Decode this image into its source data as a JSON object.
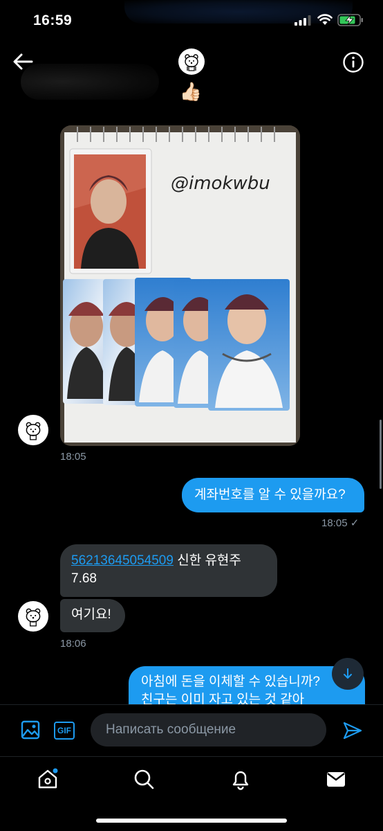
{
  "status": {
    "time": "16:59"
  },
  "header": {
    "reaction_emoji": "👍🏻"
  },
  "photo_message": {
    "image_handwriting": "@imokwbu",
    "time": "18:05"
  },
  "messages": {
    "out1": {
      "text": "계좌번호를 알 수 있을까요?",
      "time": "18:05",
      "status_icon": "✓"
    },
    "in1": {
      "account_number": "56213645054509",
      "rest": " 신한 유현주",
      "line2": "7.68"
    },
    "in2": {
      "text": "여기요!",
      "time": "18:06"
    },
    "out2": {
      "line1": "아침에 돈을 이체할 수 있습니까?",
      "line2": "친구는 이미 자고 있는 것 같아"
    }
  },
  "composer": {
    "gif_label": "GIF",
    "placeholder": "Написать сообщение"
  },
  "colors": {
    "accent": "#1d9bf0",
    "incoming_bubble": "#2f3336",
    "background": "#000000"
  },
  "tabs": [
    "home-icon",
    "search-icon",
    "notifications-icon",
    "messages-icon"
  ]
}
